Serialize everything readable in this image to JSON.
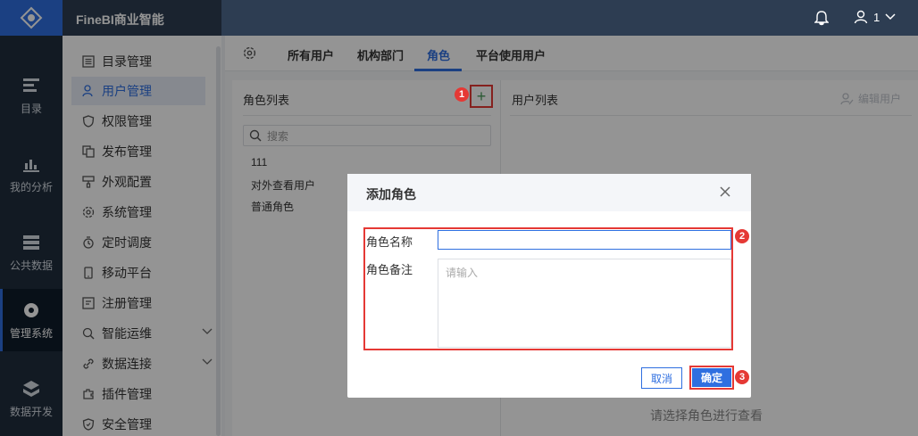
{
  "app": {
    "title": "FineBI商业智能"
  },
  "topbar": {
    "user_label": "1"
  },
  "leftnav": [
    {
      "label": "目录",
      "icon": "catalog-icon"
    },
    {
      "label": "我的分析",
      "icon": "analysis-icon"
    },
    {
      "label": "公共数据",
      "icon": "public-data-icon"
    },
    {
      "label": "管理系统",
      "icon": "manage-system-icon",
      "active": true
    },
    {
      "label": "数据开发",
      "icon": "data-dev-icon"
    }
  ],
  "sidebar": {
    "items": [
      {
        "label": "目录管理"
      },
      {
        "label": "用户管理",
        "active": true
      },
      {
        "label": "权限管理"
      },
      {
        "label": "发布管理"
      },
      {
        "label": "外观配置"
      },
      {
        "label": "系统管理"
      },
      {
        "label": "定时调度"
      },
      {
        "label": "移动平台"
      },
      {
        "label": "注册管理"
      },
      {
        "label": "智能运维",
        "expandable": true
      },
      {
        "label": "数据连接",
        "expandable": true
      },
      {
        "label": "插件管理"
      },
      {
        "label": "安全管理"
      }
    ]
  },
  "tabs": [
    {
      "label": "所有用户"
    },
    {
      "label": "机构部门"
    },
    {
      "label": "角色",
      "active": true
    },
    {
      "label": "平台使用用户"
    }
  ],
  "roles_panel": {
    "title": "角色列表",
    "search_placeholder": "搜索",
    "roles": [
      "111",
      "对外查看用户",
      "普通角色"
    ]
  },
  "users_panel": {
    "title": "用户列表",
    "edit_label": "编辑用户",
    "empty_text": "请选择角色进行查看"
  },
  "dialog": {
    "title": "添加角色",
    "name_label": "角色名称",
    "name_value": "",
    "note_label": "角色备注",
    "note_placeholder": "请输入",
    "cancel_label": "取消",
    "ok_label": "确定"
  },
  "badges": [
    "1",
    "2",
    "3"
  ],
  "colors": {
    "accent": "#2f6fe0",
    "annotation": "#e53935",
    "nav_bg": "#1f2d3d"
  }
}
